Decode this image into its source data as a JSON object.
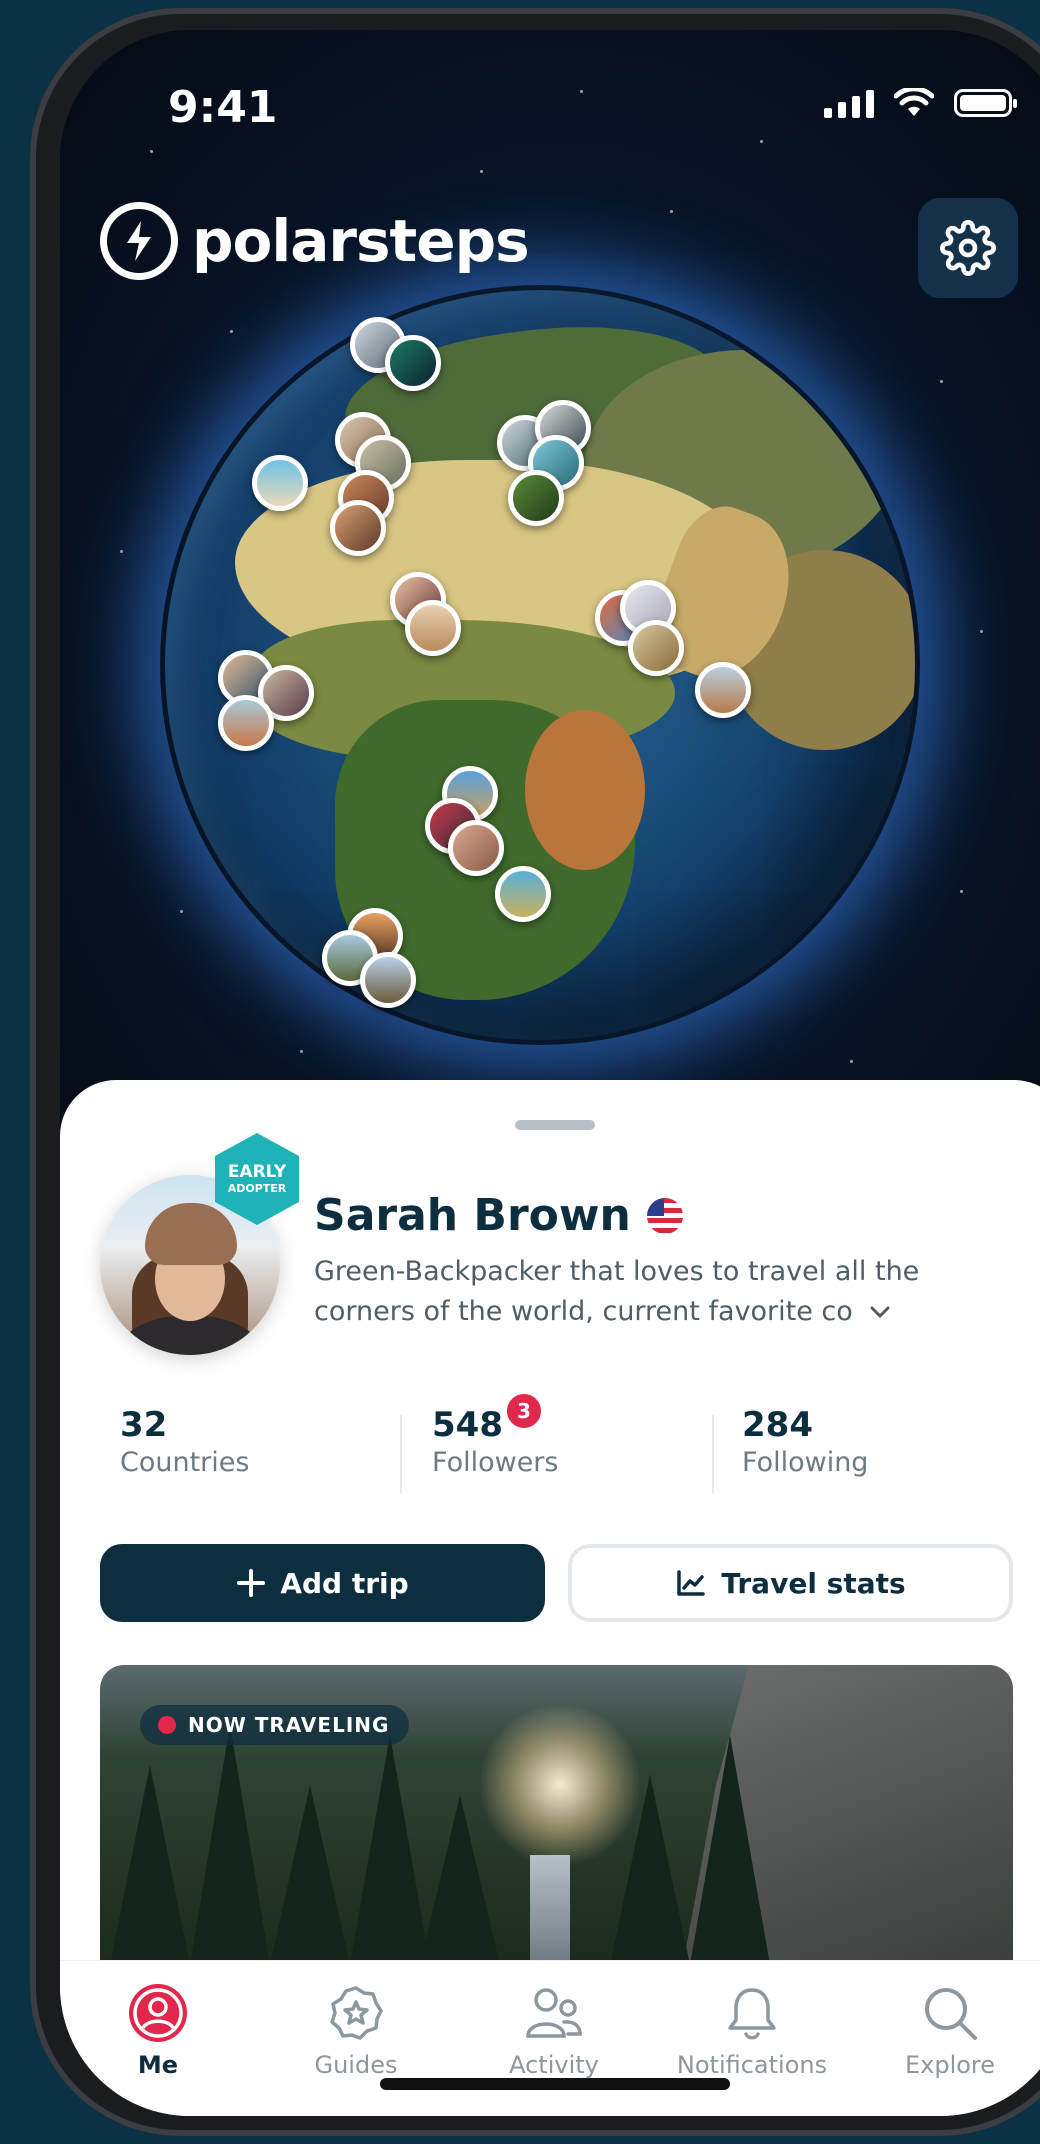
{
  "status_bar": {
    "time": "9:41"
  },
  "header": {
    "brand": "polarsteps"
  },
  "profile": {
    "badge_line1": "EARLY",
    "badge_line2": "ADOPTER",
    "name": "Sarah Brown",
    "bio": "Green-Backpacker that loves to travel all the corners of the world, current favorite co"
  },
  "stats": [
    {
      "value": "32",
      "label": "Countries"
    },
    {
      "value": "548",
      "label": "Followers",
      "badge": "3"
    },
    {
      "value": "284",
      "label": "Following"
    }
  ],
  "actions": {
    "add_trip": "Add trip",
    "travel_stats": "Travel stats"
  },
  "trip_card": {
    "status_label": "NOW TRAVELING"
  },
  "tabs": [
    {
      "label": "Me",
      "icon": "user-circle-icon",
      "active": true
    },
    {
      "label": "Guides",
      "icon": "star-badge-icon"
    },
    {
      "label": "Activity",
      "icon": "people-icon"
    },
    {
      "label": "Notifications",
      "icon": "bell-icon"
    },
    {
      "label": "Explore",
      "icon": "search-icon"
    }
  ],
  "colors": {
    "primary": "#0c2e3e",
    "accent_red": "#e2274c",
    "badge_teal": "#1fb2b6",
    "background": "#0b3144"
  }
}
